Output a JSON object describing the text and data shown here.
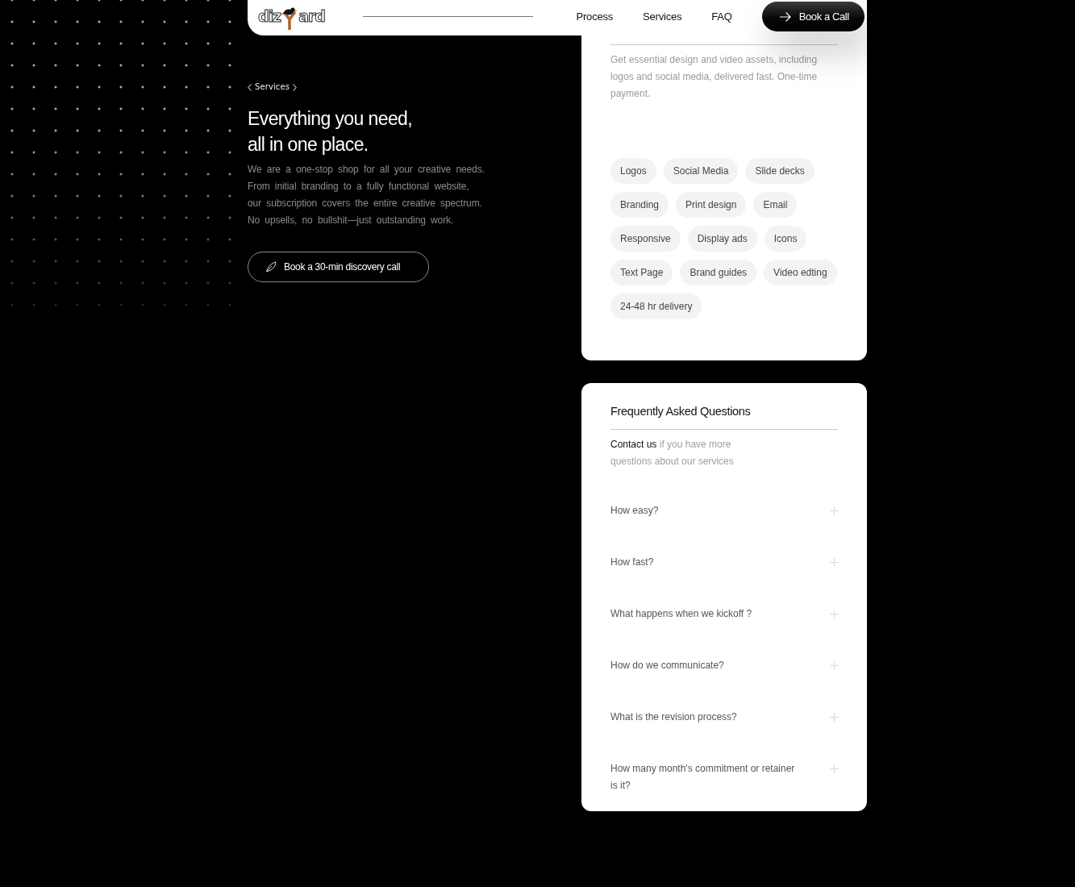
{
  "header": {
    "logo": {
      "text_start": "diz",
      "text_end": "ard"
    },
    "nav": [
      "Process",
      "Services",
      "FAQ"
    ],
    "cta": "Book a Call"
  },
  "hero": {
    "eyebrow": "Services",
    "title": "Everything you need, all in one place.",
    "description": "We are a one-stop shop for all your creative needs. From initial branding to a fully functional website, our subscription covers the entire creative spectrum. No upsells, no bullshit—just outstanding work.",
    "button": "Book a 30-min discovery call"
  },
  "services_card": {
    "description": "Get essential design and video assets, including logos and social media, delivered fast. One-time payment.",
    "tags": [
      "Logos",
      "Social Media",
      "Slide decks",
      "Branding",
      "Print design",
      "Email",
      "Responsive",
      "Display ads",
      "Icons",
      "Text Page",
      "Brand guides",
      "Video edting",
      "24-48 hr delivery"
    ]
  },
  "faq": {
    "title": "Frequently Asked Questions",
    "contact_link": "Contact us",
    "contact_text": "if you have more questions about our services",
    "items": [
      {
        "question": "How easy?",
        "expanded": false
      },
      {
        "question": "How fast?",
        "expanded": false
      },
      {
        "question": "What happens when we kickoff ?",
        "expanded": false
      },
      {
        "question": "How do we communicate?",
        "expanded": false
      },
      {
        "question": "What is the revision process?",
        "expanded": false
      },
      {
        "question": "How many month's commitment or retainer is it?",
        "expanded": false
      }
    ]
  }
}
